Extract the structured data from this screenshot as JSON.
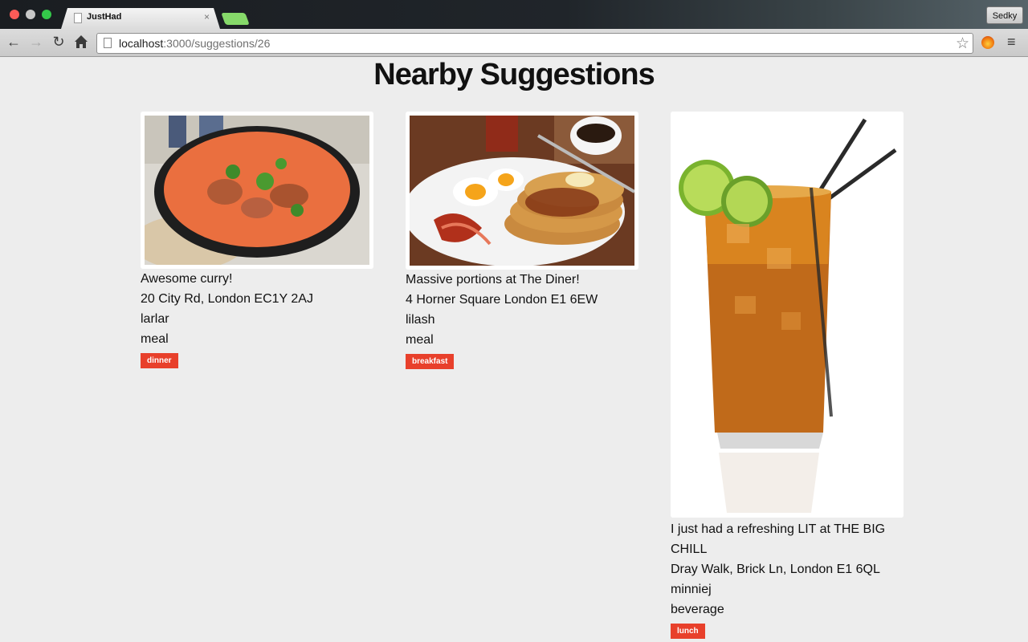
{
  "browser": {
    "tab_title": "JustHad",
    "tab_close": "×",
    "url_host": "localhost",
    "url_path": ":3000/suggestions/26",
    "profile": "Sedky"
  },
  "page": {
    "title": "Nearby Suggestions"
  },
  "suggestions": [
    {
      "image": "curry-photo",
      "text": "Awesome curry!",
      "address": "20 City Rd, London EC1Y 2AJ",
      "user": "larlar",
      "category": "meal",
      "tag": "dinner"
    },
    {
      "image": "pancakes-photo",
      "text": "Massive portions at The Diner!",
      "address": "4 Horner Square London E1 6EW",
      "user": "lilash",
      "category": "meal",
      "tag": "breakfast"
    },
    {
      "image": "iced-tea-photo",
      "text": "I just had a refreshing LIT at THE BIG CHILL",
      "address": "Dray Walk, Brick Ln, London E1 6QL",
      "user": "minniej",
      "category": "beverage",
      "tag": "lunch"
    }
  ],
  "colors": {
    "tag": "#e8402b",
    "background": "#ededed"
  }
}
